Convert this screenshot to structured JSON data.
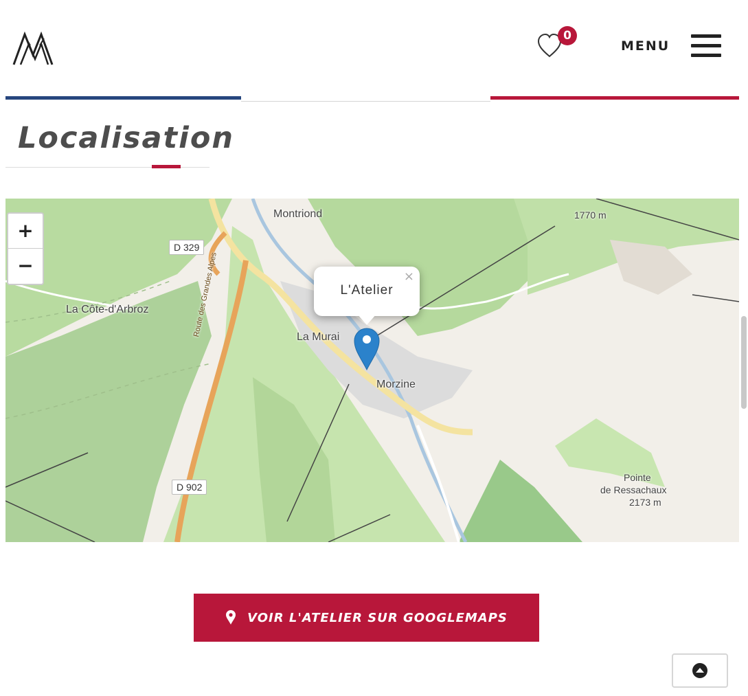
{
  "header": {
    "logo_icon": "mountains-logo-icon",
    "favorites_icon": "heart-icon",
    "favorites_count": "0",
    "menu_label": "MENU",
    "menu_icon": "hamburger-icon"
  },
  "section": {
    "title": "Localisation"
  },
  "map": {
    "zoom_in": "+",
    "zoom_out": "−",
    "popup_title": "L'Atelier",
    "popup_close": "×",
    "labels": {
      "montriond": "Montriond",
      "la_cote": "La Côte-d'Arbroz",
      "la_muraz": "La Murai",
      "morzine": "Morzine",
      "altitude1": "1770 m",
      "pointe1": "Pointe",
      "pointe2": "de Ressachaux",
      "pointe3": "2173 m",
      "route": "Route des Grandes Alpes"
    },
    "roads": {
      "d329": "D 329",
      "d902": "D 902"
    }
  },
  "cta": {
    "label": "VOIR L'ATELIER SUR GOOGLEMAPS",
    "icon": "map-pin-icon"
  },
  "back_to_top_icon": "arrow-up-circle-icon",
  "colors": {
    "brand_red": "#b8173a",
    "brand_blue": "#27467e",
    "marker_blue": "#2b82cb"
  }
}
